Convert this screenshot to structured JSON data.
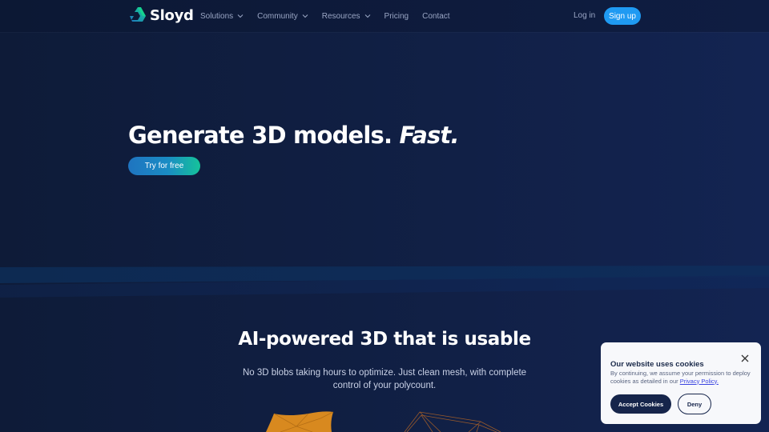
{
  "brand": {
    "name": "Sloyd",
    "logo_icon": "sloyd-logo-icon",
    "colors": {
      "accent_green": "#15c39a",
      "accent_blue": "#1f9af2",
      "navy": "#16254b"
    }
  },
  "nav": {
    "items": [
      {
        "label": "Solutions",
        "has_dropdown": true
      },
      {
        "label": "Community",
        "has_dropdown": true
      },
      {
        "label": "Resources",
        "has_dropdown": true
      },
      {
        "label": "Pricing",
        "has_dropdown": false
      },
      {
        "label": "Contact",
        "has_dropdown": false
      }
    ],
    "login_label": "Log in",
    "signup_label": "Sign up"
  },
  "hero": {
    "title_main": "Generate 3D models.",
    "title_emphasis": "Fast.",
    "cta_label": "Try for free"
  },
  "features": {
    "title": "AI-powered 3D that is usable",
    "subtitle": "No 3D blobs taking hours to optimize. Just clean mesh, with complete control of your polycount."
  },
  "cookie_banner": {
    "title": "Our website uses cookies",
    "text": "By continuing, we assume your permission to deploy cookies as detailed in our",
    "link_label": "Privacy Policy.",
    "accept_label": "Accept Cookies",
    "deny_label": "Deny",
    "close_icon": "close-icon"
  }
}
